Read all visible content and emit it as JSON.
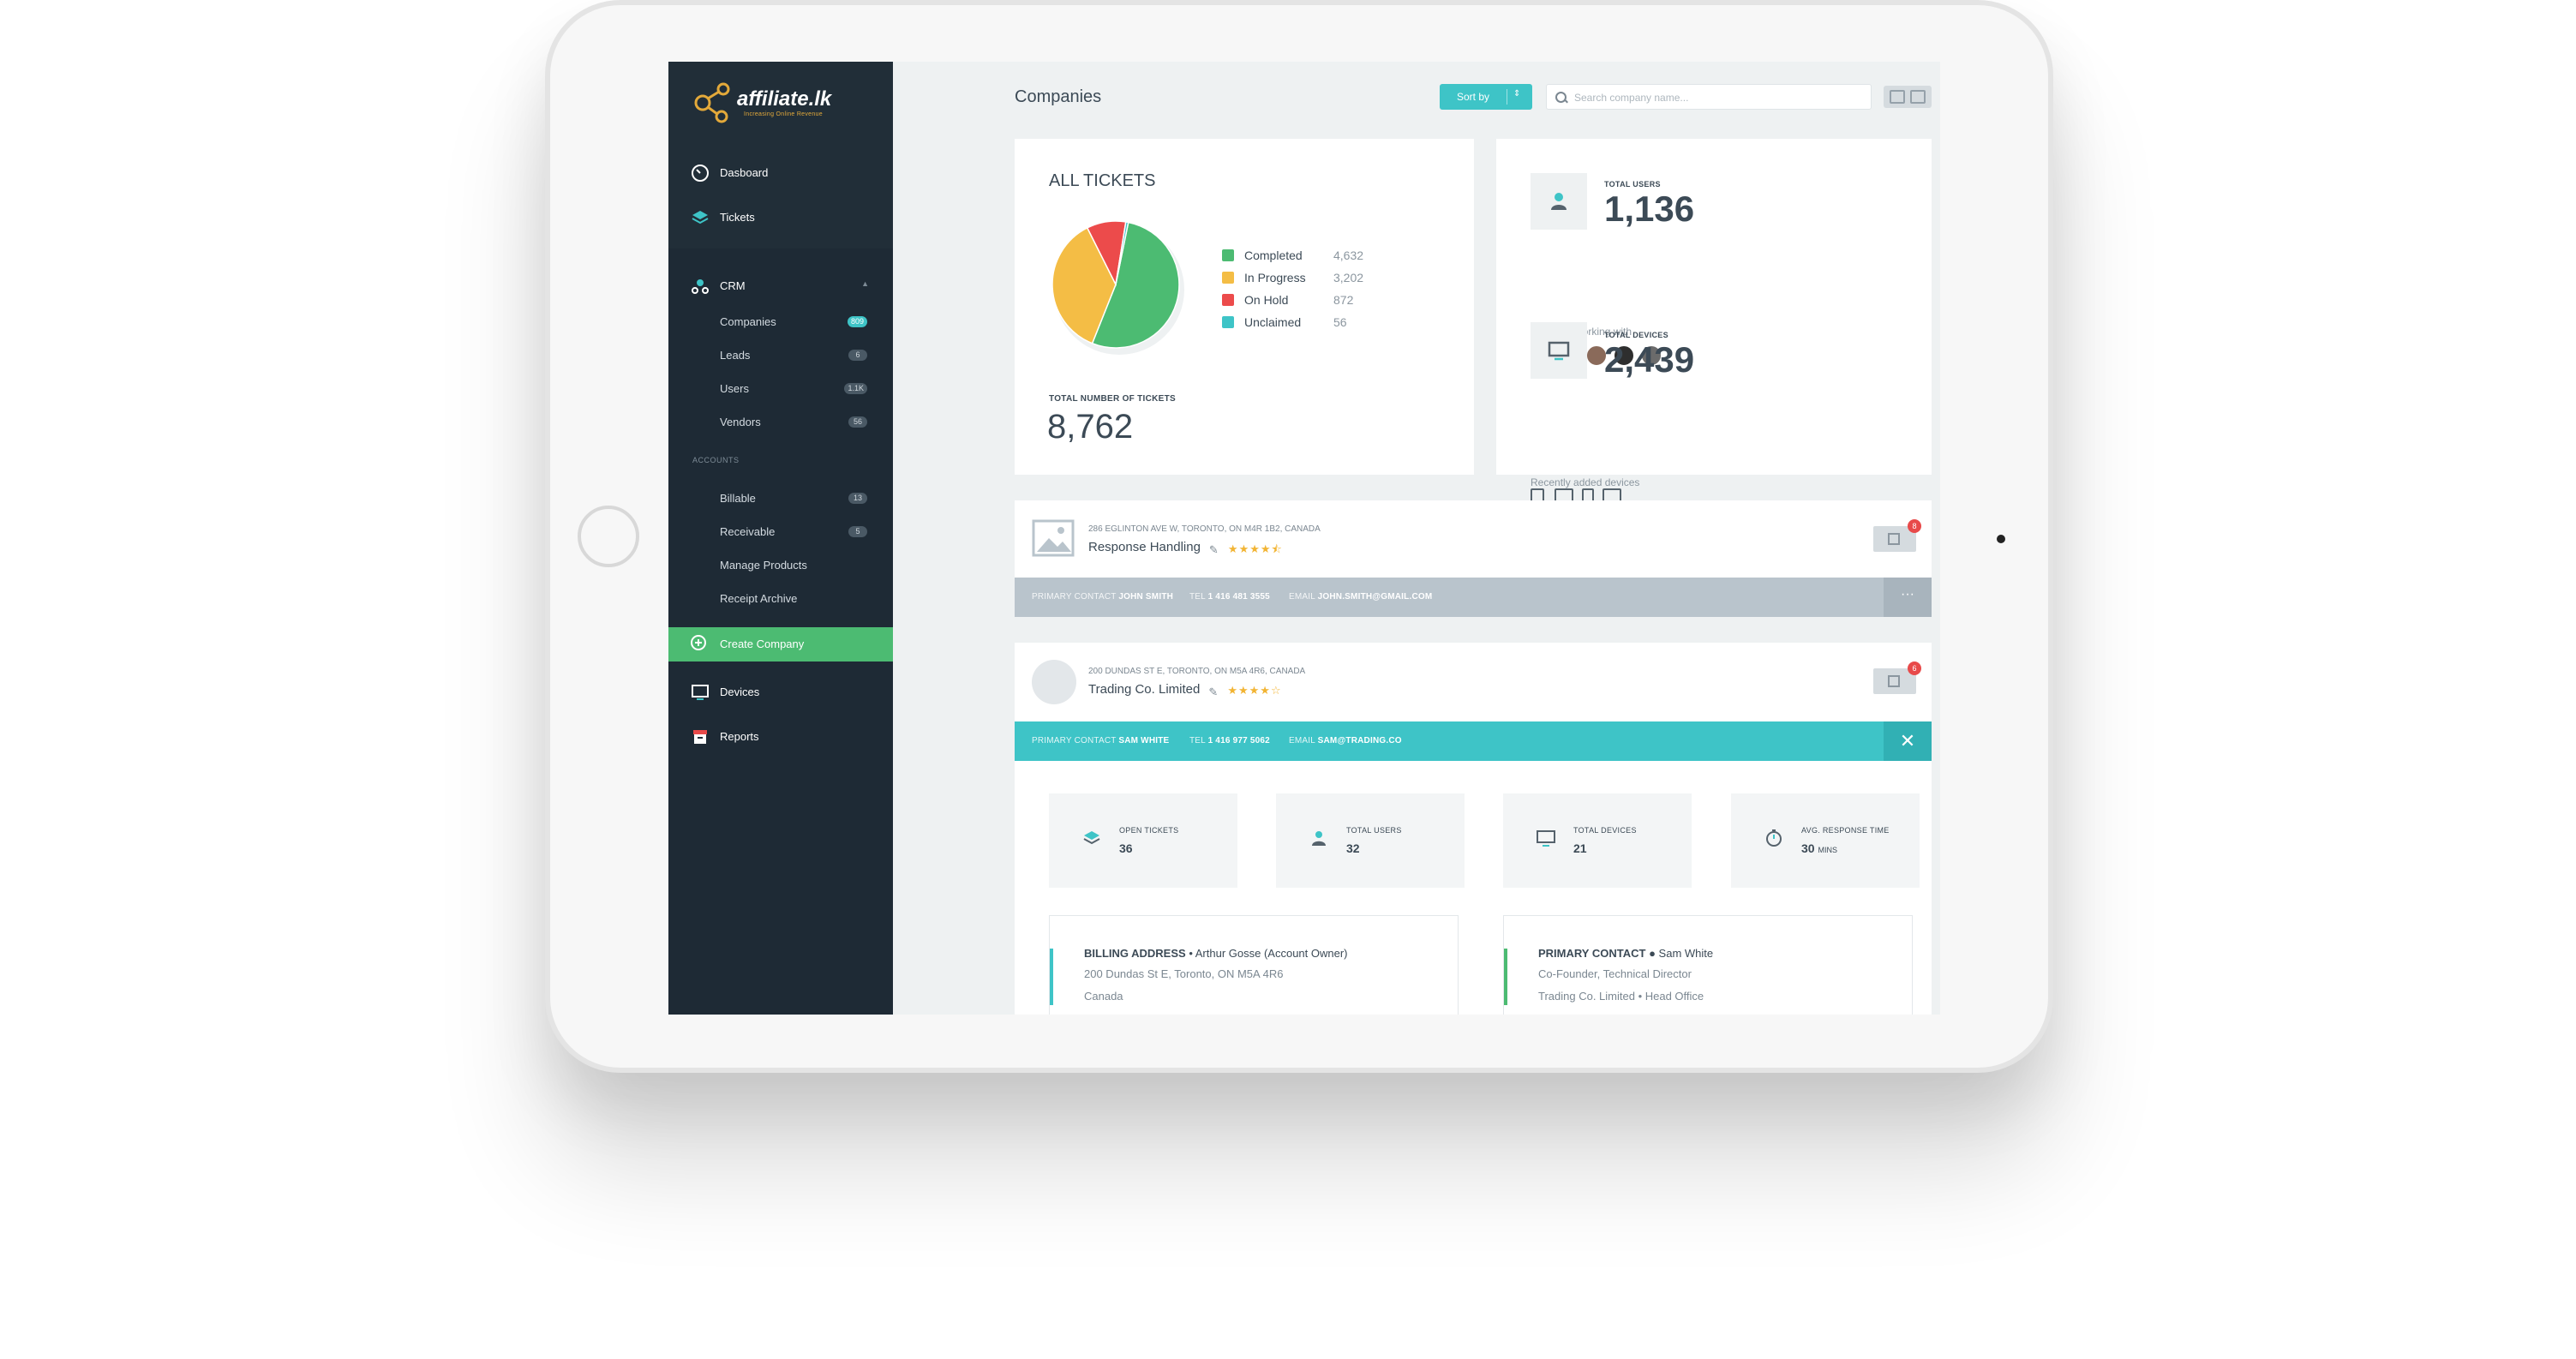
{
  "brand": {
    "name": "affiliate.lk",
    "tagline": "Increasing Online Revenue"
  },
  "sidebar": {
    "main": [
      {
        "label": "Dasboard",
        "icon": "dashboard-icon"
      },
      {
        "label": "Tickets",
        "icon": "layers-icon"
      }
    ],
    "crm": {
      "label": "CRM",
      "items": [
        {
          "label": "Companies",
          "badge": "809"
        },
        {
          "label": "Leads",
          "badge": "6"
        },
        {
          "label": "Users",
          "badge": "1.1K"
        },
        {
          "label": "Vendors",
          "badge": "56"
        }
      ]
    },
    "accounts": {
      "label": "ACCOUNTS",
      "items": [
        {
          "label": "Billable",
          "badge": "13"
        },
        {
          "label": "Receivable",
          "badge": "5"
        },
        {
          "label": "Manage Products",
          "badge": ""
        },
        {
          "label": "Receipt Archive",
          "badge": ""
        }
      ]
    },
    "create_label": "Create Company",
    "bottom": [
      {
        "label": "Devices",
        "icon": "monitor-icon"
      },
      {
        "label": "Reports",
        "icon": "archive-icon"
      }
    ]
  },
  "header": {
    "title": "Companies",
    "sort_label": "Sort by",
    "search_placeholder": "Search company name..."
  },
  "tickets": {
    "title": "ALL TICKETS",
    "total_label": "TOTAL NUMBER OF TICKETS",
    "total": "8,762"
  },
  "chart_data": {
    "type": "pie",
    "title": "ALL TICKETS",
    "categories": [
      "Completed",
      "In Progress",
      "On Hold",
      "Unclaimed"
    ],
    "values": [
      4632,
      3202,
      872,
      56
    ],
    "value_labels": [
      "4,632",
      "3,202",
      "872",
      "56"
    ],
    "colors": [
      "#4cbb72",
      "#f4bd45",
      "#ec4b4b",
      "#3ec4c7"
    ]
  },
  "stats": {
    "users": {
      "label": "TOTAL USERS",
      "value": "1,136",
      "sub": "Currently working with",
      "avatar_count": 5
    },
    "devices": {
      "label": "TOTAL DEVICES",
      "value": "2,439",
      "sub": "Recently added devices"
    }
  },
  "companies": [
    {
      "address": "286 EGLINTON AVE W, TORONTO, ON M4R 1B2, CANADA",
      "name": "Response Handling",
      "rating": 4.5,
      "notifications": "8",
      "contact": {
        "k1": "PRIMARY CONTACT",
        "name": "JOHN SMITH",
        "k2": "TEL",
        "tel": "1 416 481 3555",
        "k3": "EMAIL",
        "email": "JOHN.SMITH@GMAIL.COM"
      },
      "action": "···"
    },
    {
      "address": "200 DUNDAS ST E, TORONTO, ON M5A 4R6, CANADA",
      "name": "Trading Co. Limited",
      "rating": 4,
      "notifications": "6",
      "contact": {
        "k1": "PRIMARY CONTACT",
        "name": "SAM WHITE",
        "k2": "TEL",
        "tel": "1 416 977 5062",
        "k3": "EMAIL",
        "email": "SAM@TRADING.CO"
      },
      "action": "✕",
      "kpis": [
        {
          "label": "OPEN TICKETS",
          "value": "36",
          "unit": ""
        },
        {
          "label": "TOTAL USERS",
          "value": "32",
          "unit": ""
        },
        {
          "label": "TOTAL DEVICES",
          "value": "21",
          "unit": ""
        },
        {
          "label": "AVG. RESPONSE TIME",
          "value": "30",
          "unit": "MINS"
        }
      ],
      "billing": {
        "title": "BILLING ADDRESS",
        "owner": "Arthur Gosse (Account Owner)",
        "line1": "200 Dundas St E, Toronto, ON M5A 4R6",
        "line2": "Canada"
      },
      "primary": {
        "title": "PRIMARY CONTACT",
        "name": "Sam White",
        "line1": "Co-Founder, Technical Director",
        "line2": "Trading Co. Limited  •  Head Office"
      }
    }
  ]
}
